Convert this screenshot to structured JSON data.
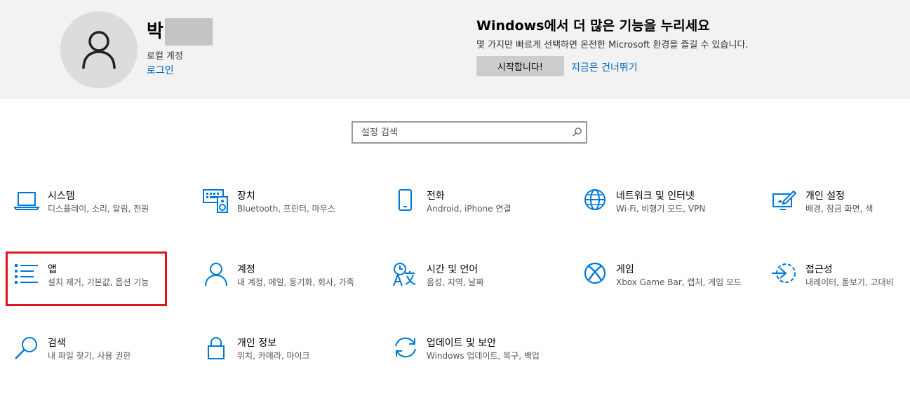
{
  "user": {
    "name": "박",
    "type": "로컬 계정",
    "login_link": "로그인"
  },
  "promo": {
    "title": "Windows에서 더 많은 기능을 누리세요",
    "description": "몇 가지만 빠르게 선택하면 온전한 Microsoft 환경을 즐길 수 있습니다.",
    "start_button": "시작합니다!",
    "skip_link": "지금은 건너뛰기"
  },
  "search": {
    "placeholder": "설정 검색"
  },
  "colors": {
    "accent": "#0067b8",
    "icon": "#0078d7",
    "highlight": "#e0141e"
  },
  "tiles": [
    {
      "name": "시스템",
      "desc": "디스플레이, 소리, 알림, 전원",
      "icon": "laptop-icon"
    },
    {
      "name": "장치",
      "desc": "Bluetooth, 프린터, 마우스",
      "icon": "keyboard-speaker-icon"
    },
    {
      "name": "전화",
      "desc": "Android, iPhone 연결",
      "icon": "phone-icon"
    },
    {
      "name": "네트워크 및 인터넷",
      "desc": "Wi-Fi, 비행기 모드, VPN",
      "icon": "globe-icon"
    },
    {
      "name": "개인 설정",
      "desc": "배경, 잠금 화면, 색",
      "icon": "personalization-icon"
    },
    {
      "name": "앱",
      "desc": "설치 제거, 기본값, 옵션 기능",
      "icon": "apps-list-icon"
    },
    {
      "name": "계정",
      "desc": "내 계정, 메일, 동기화, 회사, 가족",
      "icon": "person-icon"
    },
    {
      "name": "시간 및 언어",
      "desc": "음성, 지역, 날짜",
      "icon": "time-language-icon"
    },
    {
      "name": "게임",
      "desc": "Xbox Game Bar, 캡처, 게임 모드",
      "icon": "xbox-icon"
    },
    {
      "name": "접근성",
      "desc": "내레이터, 돋보기, 고대비",
      "icon": "ease-of-access-icon"
    },
    {
      "name": "검색",
      "desc": "내 파일 찾기, 사용 권한",
      "icon": "search-magnifier-icon"
    },
    {
      "name": "개인 정보",
      "desc": "위치, 카메라, 마이크",
      "icon": "lock-icon"
    },
    {
      "name": "업데이트 및 보안",
      "desc": "Windows 업데이트, 복구, 백업",
      "icon": "sync-icon"
    }
  ]
}
